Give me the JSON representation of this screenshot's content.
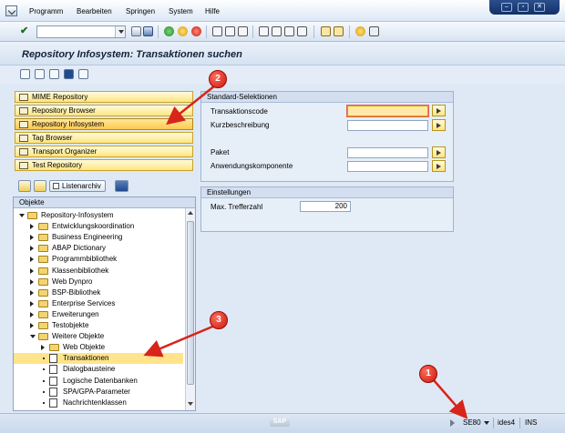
{
  "menubar": {
    "items": [
      "Programm",
      "Bearbeiten",
      "Springen",
      "System",
      "Hilfe"
    ]
  },
  "window_controls": [
    "–",
    "▫",
    "✕"
  ],
  "page": {
    "title": "Repository Infosystem: Transaktionen suchen"
  },
  "navigation": {
    "buttons": [
      {
        "label": "MIME Repository",
        "active": false
      },
      {
        "label": "Repository Browser",
        "active": false
      },
      {
        "label": "Repository Infosystem",
        "active": true
      },
      {
        "label": "Tag Browser",
        "active": false
      },
      {
        "label": "Transport Organizer",
        "active": false
      },
      {
        "label": "Test Repository",
        "active": false
      }
    ],
    "tree_toolbar": {
      "listenarchiv_label": "Listenarchiv"
    }
  },
  "tree": {
    "header": "Objekte",
    "nodes": [
      {
        "label": "Repository-Infosystem",
        "level": 0,
        "kind": "folder",
        "state": "open",
        "selected": false
      },
      {
        "label": "Entwicklungskoordination",
        "level": 1,
        "kind": "folder",
        "state": "closed",
        "selected": false
      },
      {
        "label": "Business Engineering",
        "level": 1,
        "kind": "folder",
        "state": "closed",
        "selected": false
      },
      {
        "label": "ABAP Dictionary",
        "level": 1,
        "kind": "folder",
        "state": "closed",
        "selected": false
      },
      {
        "label": "Programmbibliothek",
        "level": 1,
        "kind": "folder",
        "state": "closed",
        "selected": false
      },
      {
        "label": "Klassenbibliothek",
        "level": 1,
        "kind": "folder",
        "state": "closed",
        "selected": false
      },
      {
        "label": "Web Dynpro",
        "level": 1,
        "kind": "folder",
        "state": "closed",
        "selected": false
      },
      {
        "label": "BSP-Bibliothek",
        "level": 1,
        "kind": "folder",
        "state": "closed",
        "selected": false
      },
      {
        "label": "Enterprise Services",
        "level": 1,
        "kind": "folder",
        "state": "closed",
        "selected": false
      },
      {
        "label": "Erweiterungen",
        "level": 1,
        "kind": "folder",
        "state": "closed",
        "selected": false
      },
      {
        "label": "Testobjekte",
        "level": 1,
        "kind": "folder",
        "state": "closed",
        "selected": false
      },
      {
        "label": "Weitere Objekte",
        "level": 1,
        "kind": "folder",
        "state": "open",
        "selected": false
      },
      {
        "label": "Web Objekte",
        "level": 2,
        "kind": "folder",
        "state": "closed",
        "selected": false
      },
      {
        "label": "Transaktionen",
        "level": 2,
        "kind": "doc",
        "state": "leaf",
        "selected": true
      },
      {
        "label": "Dialogbausteine",
        "level": 2,
        "kind": "doc",
        "state": "leaf",
        "selected": false
      },
      {
        "label": "Logische Datenbanken",
        "level": 2,
        "kind": "doc",
        "state": "leaf",
        "selected": false
      },
      {
        "label": "SPA/GPA-Parameter",
        "level": 2,
        "kind": "doc",
        "state": "leaf",
        "selected": false
      },
      {
        "label": "Nachrichtenklassen",
        "level": 2,
        "kind": "doc",
        "state": "leaf",
        "selected": false
      }
    ]
  },
  "standard_selection": {
    "title": "Standard-Selektionen",
    "fields": [
      {
        "label": "Transaktionscode",
        "value": "",
        "focused": true,
        "has_more": true
      },
      {
        "label": "Kurzbeschreibung",
        "value": "",
        "focused": false,
        "has_more": true
      },
      {
        "label": "Paket",
        "value": "",
        "focused": false,
        "has_more": true
      },
      {
        "label": "Anwendungskomponente",
        "value": "",
        "focused": false,
        "has_more": true
      }
    ]
  },
  "settings": {
    "title": "Einstellungen",
    "max_hits_label": "Max. Trefferzahl",
    "max_hits_value": "200"
  },
  "statusbar": {
    "logo": "SAP",
    "transaction": "SE80",
    "system": "ides4",
    "mode": "INS"
  },
  "annotations": [
    {
      "number": "1"
    },
    {
      "number": "2"
    },
    {
      "number": "3"
    }
  ],
  "colors": {
    "annotation": "#d8241a",
    "nav_button": "#ffe57d",
    "selected_row": "#ffe48b",
    "background": "#dfe9f5"
  }
}
